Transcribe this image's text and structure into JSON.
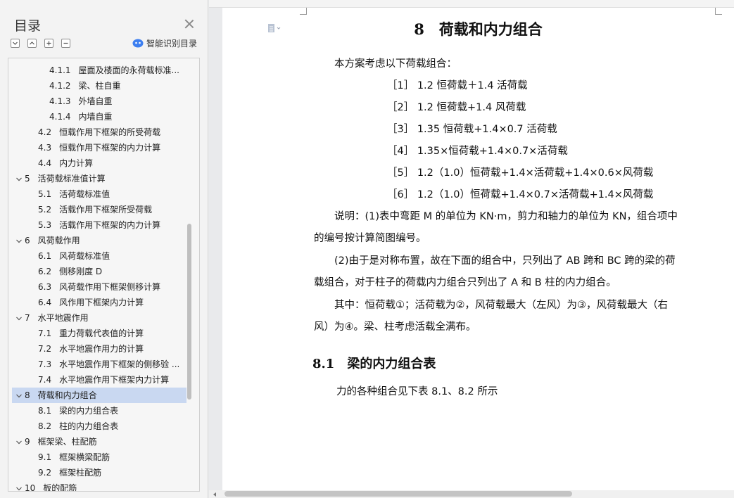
{
  "nav": {
    "title": "目录",
    "smart_toc_label": "智能识别目录",
    "items": [
      {
        "num": "4.1.1",
        "label": "屋面及楼面的永荷载标准...",
        "level": 3,
        "expandable": false,
        "selected": false
      },
      {
        "num": "4.1.2",
        "label": "梁、柱自重",
        "level": 3,
        "expandable": false,
        "selected": false
      },
      {
        "num": "4.1.3",
        "label": "外墙自重",
        "level": 3,
        "expandable": false,
        "selected": false
      },
      {
        "num": "4.1.4",
        "label": "内墙自重",
        "level": 3,
        "expandable": false,
        "selected": false
      },
      {
        "num": "4.2",
        "label": "恒载作用下框架的所受荷载",
        "level": 2,
        "expandable": false,
        "selected": false
      },
      {
        "num": "4.3",
        "label": "恒载作用下框架的内力计算",
        "level": 2,
        "expandable": false,
        "selected": false
      },
      {
        "num": "4.4",
        "label": "内力计算",
        "level": 2,
        "expandable": false,
        "selected": false
      },
      {
        "num": "5",
        "label": "活荷载标准值计算",
        "level": 1,
        "expandable": true,
        "selected": false
      },
      {
        "num": "5.1",
        "label": "活荷载标准值",
        "level": 2,
        "expandable": false,
        "selected": false
      },
      {
        "num": "5.2",
        "label": "活载作用下框架所受荷载",
        "level": 2,
        "expandable": false,
        "selected": false
      },
      {
        "num": "5.3",
        "label": "活载作用下框架的内力计算",
        "level": 2,
        "expandable": false,
        "selected": false
      },
      {
        "num": "6",
        "label": "风荷载作用",
        "level": 1,
        "expandable": true,
        "selected": false
      },
      {
        "num": "6.1",
        "label": "风荷载标准值",
        "level": 2,
        "expandable": false,
        "selected": false
      },
      {
        "num": "6.2",
        "label": "侧移刚度 D",
        "level": 2,
        "expandable": false,
        "selected": false
      },
      {
        "num": "6.3",
        "label": "风荷载作用下框架侧移计算",
        "level": 2,
        "expandable": false,
        "selected": false
      },
      {
        "num": "6.4",
        "label": "风作用下框架内力计算",
        "level": 2,
        "expandable": false,
        "selected": false
      },
      {
        "num": "7",
        "label": "水平地震作用",
        "level": 1,
        "expandable": true,
        "selected": false
      },
      {
        "num": "7.1",
        "label": "重力荷载代表值的计算",
        "level": 2,
        "expandable": false,
        "selected": false
      },
      {
        "num": "7.2",
        "label": "水平地震作用力的计算",
        "level": 2,
        "expandable": false,
        "selected": false
      },
      {
        "num": "7.3",
        "label": "水平地震作用下框架的侧移验 ...",
        "level": 2,
        "expandable": false,
        "selected": false
      },
      {
        "num": "7.4",
        "label": "水平地震作用下框架内力计算",
        "level": 2,
        "expandable": false,
        "selected": false
      },
      {
        "num": "8",
        "label": "荷载和内力组合",
        "level": 1,
        "expandable": true,
        "selected": true
      },
      {
        "num": "8.1",
        "label": "梁的内力组合表",
        "level": 2,
        "expandable": false,
        "selected": false
      },
      {
        "num": "8.2",
        "label": "柱的内力组合表",
        "level": 2,
        "expandable": false,
        "selected": false
      },
      {
        "num": "9",
        "label": "框架梁、柱配筋",
        "level": 1,
        "expandable": true,
        "selected": false
      },
      {
        "num": "9.1",
        "label": "框架横梁配筋",
        "level": 2,
        "expandable": false,
        "selected": false
      },
      {
        "num": "9.2",
        "label": "框架柱配筋",
        "level": 2,
        "expandable": false,
        "selected": false
      },
      {
        "num": "10",
        "label": "板的配筋",
        "level": 1,
        "expandable": true,
        "selected": false
      }
    ]
  },
  "doc": {
    "heading": "8　荷载和内力组合",
    "intro": "本方案考虑以下荷载组合：",
    "combos": [
      "［1］ 1.2 恒荷载＋1.4 活荷载",
      "［2］ 1.2 恒荷载+1.4 风荷载",
      "［3］ 1.35 恒荷载+1.4×0.7 活荷载",
      "［4］ 1.35×恒荷载+1.4×0.7×活荷载",
      "［5］ 1.2（1.0）恒荷载+1.4×活荷载+1.4×0.6×风荷载",
      "［6］ 1.2（1.0）恒荷载+1.4×0.7×活荷载+1.4×风荷载"
    ],
    "note1_line1": "说明：(1)表中弯距 M 的单位为 KN·m，剪力和轴力的单位为 KN，组合项中",
    "note1_line2": "的编号按计算简图编号。",
    "note2_line1": "(2)由于是对称布置，故在下面的组合中，只列出了 AB 跨和 BC 跨的梁的荷",
    "note2_line2": "载组合，对于柱子的荷载内力组合只列出了 A 和 B 柱的内力组合。",
    "note3_line1": "其中：恒荷载①；活荷载为②，风荷载最大（左风）为③，风荷载最大（右",
    "note3_line2": "风）为④。梁、柱考虑活载全满布。",
    "subheading": "8.1　梁的内力组合表",
    "sub_para": "力的各种组合见下表 8.1、8.2 所示"
  }
}
